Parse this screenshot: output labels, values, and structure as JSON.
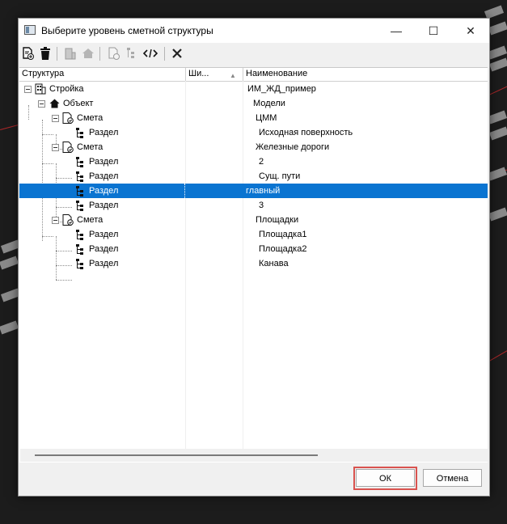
{
  "window": {
    "title": "Выберите уровень сметной структуры",
    "minimize": "—",
    "maximize": "☐",
    "close": "✕"
  },
  "toolbar": {
    "buttons": [
      {
        "icon": "add-document-icon"
      },
      {
        "icon": "trash-icon"
      },
      {
        "icon": "building-icon"
      },
      {
        "icon": "house-icon"
      },
      {
        "icon": "estimate-icon"
      },
      {
        "icon": "section-icon"
      },
      {
        "icon": "code-icon"
      },
      {
        "icon": "delete-x-icon"
      }
    ]
  },
  "columns": {
    "structure": "Структура",
    "width": "Ши...",
    "name": "Наименование"
  },
  "rows": [
    {
      "label": "Стройка",
      "name": "ИМ_ЖД_пример",
      "type": "building"
    },
    {
      "label": "Объект",
      "name": "Модели",
      "type": "object"
    },
    {
      "label": "Смета",
      "name": "ЦММ",
      "type": "estimate"
    },
    {
      "label": "Раздел",
      "name": "Исходная поверхность",
      "type": "section"
    },
    {
      "label": "Смета",
      "name": "Железные дороги",
      "type": "estimate"
    },
    {
      "label": "Раздел",
      "name": "2",
      "type": "section"
    },
    {
      "label": "Раздел",
      "name": "Сущ. пути",
      "type": "section"
    },
    {
      "label": "Раздел",
      "name": "главный",
      "type": "section",
      "selected": true
    },
    {
      "label": "Раздел",
      "name": "3",
      "type": "section"
    },
    {
      "label": "Смета",
      "name": "Площадки",
      "type": "estimate"
    },
    {
      "label": "Раздел",
      "name": "Площадка1",
      "type": "section"
    },
    {
      "label": "Раздел",
      "name": "Площадка2",
      "type": "section"
    },
    {
      "label": "Раздел",
      "name": "Канава",
      "type": "section"
    }
  ],
  "buttons": {
    "ok": "ОК",
    "cancel": "Отмена"
  },
  "colors": {
    "selection": "#0a74d1",
    "highlight": "#d9534f"
  }
}
